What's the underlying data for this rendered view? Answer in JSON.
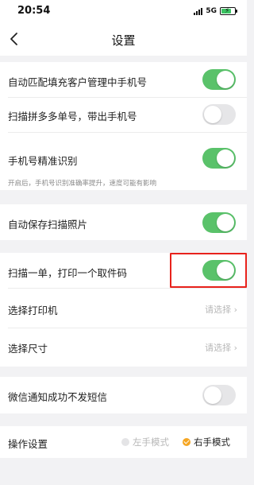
{
  "status_bar": {
    "time": "20:54",
    "network": "5G"
  },
  "nav": {
    "title": "设置"
  },
  "settings": {
    "auto_fill": {
      "label": "自动匹配填充客户管理中手机号",
      "enabled": true
    },
    "scan_pdd": {
      "label": "扫描拼多多单号，带出手机号",
      "enabled": false
    },
    "phone_recognition": {
      "label": "手机号精准识别",
      "enabled": true,
      "hint": "开启后，手机号识别准确率提升，速度可能有影响"
    },
    "auto_save_photo": {
      "label": "自动保存扫描照片",
      "enabled": true
    },
    "scan_print": {
      "label": "扫描一单，打印一个取件码",
      "enabled": true
    },
    "printer": {
      "label": "选择打印机",
      "value": "请选择"
    },
    "size": {
      "label": "选择尺寸",
      "value": "请选择"
    },
    "wechat_sms": {
      "label": "微信通知成功不发短信",
      "enabled": false
    },
    "operation": {
      "label": "操作设置",
      "options": [
        "左手模式",
        "右手模式"
      ],
      "selected": "右手模式"
    }
  },
  "colors": {
    "toggle_on": "#5ac26a",
    "toggle_off": "#e6e6e8",
    "highlight": "#e8221c",
    "radio_selected": "#f5a623"
  }
}
